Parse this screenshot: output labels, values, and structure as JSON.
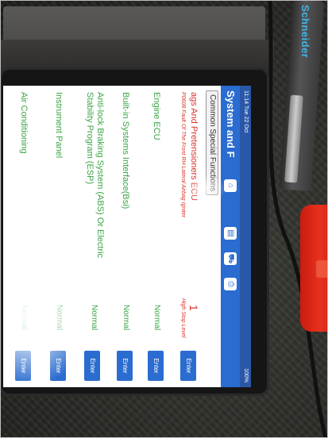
{
  "status_bar": {
    "time": "11:14",
    "date": "Tue 22 Oct",
    "battery": "100%"
  },
  "header": {
    "title": "System and F",
    "home_icon": "home-icon",
    "doc_icon": "document-icon",
    "car_icon": "car-icon",
    "print_icon": "print-icon"
  },
  "sub_header": {
    "tab_label": "Common Special Functions"
  },
  "rows": [
    {
      "name": "ags And Pretensioners ECU",
      "status": "1",
      "fault": "P0608 Fault Of The Front RH Lateral Airbag Igniter",
      "fault_right": "High Stop Level",
      "enter": "Enter",
      "status_color": "red"
    },
    {
      "name": "Engine ECU",
      "status": "Normal",
      "enter": "Enter",
      "status_color": "green"
    },
    {
      "name": "Built-in Systems Interface(Bsi)",
      "status": "Normal",
      "enter": "Enter",
      "status_color": "green"
    },
    {
      "name": "Anti-lock Braking System (ABS) Or Electric Stability Program (ESP)",
      "status": "Normal",
      "enter": "Enter",
      "status_color": "green"
    },
    {
      "name": "Instrument Panel",
      "status": "Normal",
      "enter": "Enter",
      "status_color": "green"
    },
    {
      "name": "Air Conditioning",
      "status": "Normal",
      "enter": "Enter",
      "status_color": "green"
    }
  ],
  "pen": {
    "brand": "Schneider"
  },
  "colors": {
    "header_blue": "#2a6ccf",
    "normal_green": "#3aa544",
    "fault_red": "#d8342c",
    "device_red": "#e8321f"
  }
}
